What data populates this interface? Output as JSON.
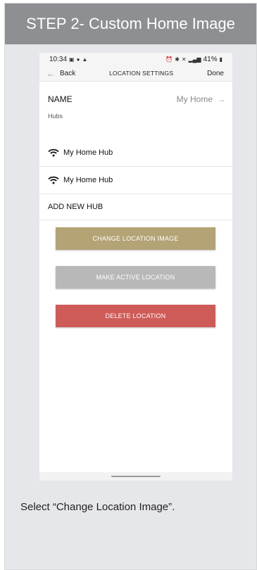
{
  "header": {
    "title": "STEP 2- Custom Home Image"
  },
  "status_bar": {
    "time": "10:34",
    "battery": "41%"
  },
  "nav": {
    "back_label": "Back",
    "title": "LOCATION SETTINGS",
    "done_label": "Done"
  },
  "name_row": {
    "label": "NAME",
    "value": "My Home"
  },
  "hubs": {
    "section_label": "Hubs",
    "items": [
      {
        "label": "My Home Hub"
      },
      {
        "label": "My Home Hub"
      }
    ],
    "add_label": "ADD NEW HUB"
  },
  "buttons": {
    "change_image": "CHANGE LOCATION IMAGE",
    "make_active": "MAKE ACTIVE LOCATION",
    "delete": "DELETE LOCATION"
  },
  "colors": {
    "header_bg": "#8d8f92",
    "card_bg": "#e6e7ea",
    "change_btn": "#b3a375",
    "active_btn": "#b8b8b8",
    "delete_btn": "#cf5b58",
    "back_arrow": "#b09a6a"
  },
  "icons": {
    "hub_icon": "wifi-icon",
    "back_icon": "arrow-left-icon",
    "name_chevron": "arrow-right-icon"
  },
  "caption": "Select “Change Location Image”."
}
